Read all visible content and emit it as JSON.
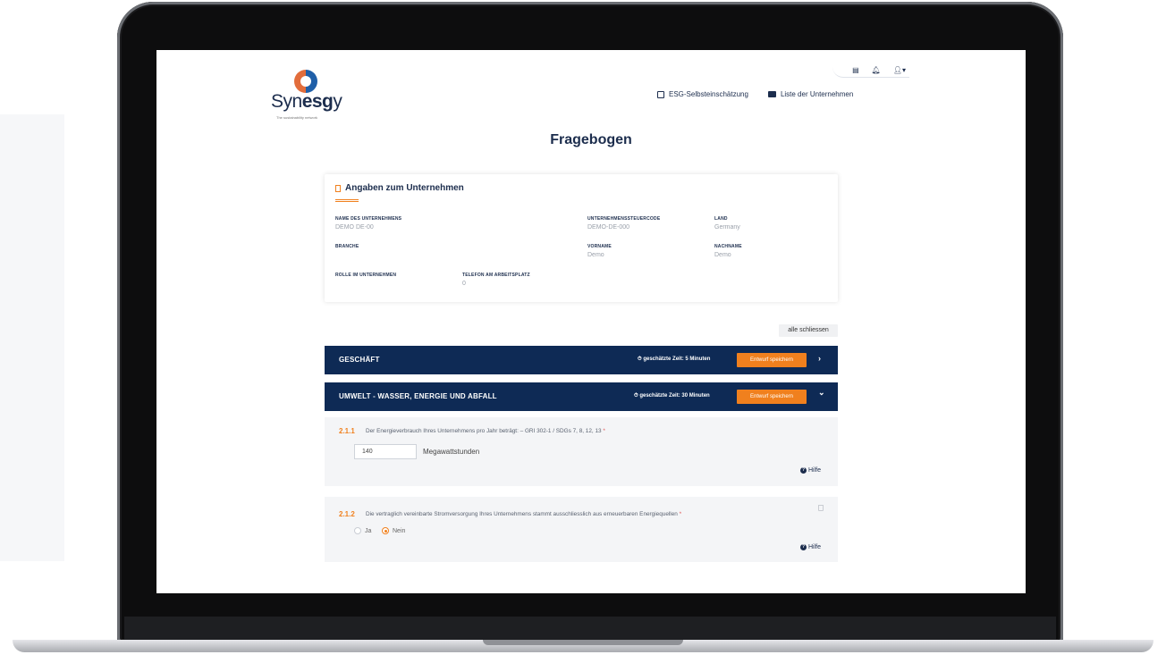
{
  "brand": {
    "name_prefix": "Syn",
    "name_bold": "esg",
    "name_suffix": "y",
    "tagline": "The sustainability network"
  },
  "topicons": [
    "flag-icon",
    "bell-icon",
    "user-icon"
  ],
  "nav": {
    "self_assessment": "ESG-Selbsteinschätzung",
    "companies": "Liste der Unternehmen"
  },
  "page": {
    "title": "Fragebogen"
  },
  "company_card": {
    "title": "Angaben zum Unternehmen",
    "fields": {
      "company_name": {
        "label": "NAME DES UNTERNEHMENS",
        "value": "DEMO DE-00"
      },
      "tax_code": {
        "label": "UNTERNEHMENSSTEUERCODE",
        "value": "DEMO-DE-000"
      },
      "country": {
        "label": "LAND",
        "value": "Germany"
      },
      "industry": {
        "label": "BRANCHE",
        "value": ""
      },
      "first_name": {
        "label": "VORNAME",
        "value": "Demo"
      },
      "last_name": {
        "label": "NACHNAME",
        "value": "Demo"
      },
      "role": {
        "label": "ROLLE IM UNTERNEHMEN",
        "value": ""
      },
      "phone": {
        "label": "TELEFON AM ARBEITSPLATZ",
        "value": "0"
      }
    }
  },
  "close_all": "alle schliessen",
  "sections": [
    {
      "title": "GESCHÄFT",
      "time": "⏱ geschätzte Zeit: 5 Minuten",
      "button": "Entwurf speichern",
      "chevron": "›"
    },
    {
      "title": "UMWELT - WASSER, ENERGIE UND ABFALL",
      "time": "⏱ geschätzte Zeit: 30 Minuten",
      "button": "Entwurf speichern",
      "chevron": "⌄"
    }
  ],
  "questions": [
    {
      "number": "2.1.1",
      "text": "Der Energieverbrauch Ihres Unternehmens pro Jahr beträgt: – GRI 302-1 / SDGs 7, 8, 12, 13",
      "required_mark": "*",
      "input_value": "140",
      "unit": "Megawattstunden",
      "help": "Hilfe"
    },
    {
      "number": "2.1.2",
      "text": "Die vertraglich vereinbarte Stromversorgung Ihres Unternehmens stammt ausschliesslich aus erneuerbaren Energiequellen",
      "required_mark": "*",
      "options": [
        "Ja",
        "Nein"
      ],
      "selected": "Nein",
      "help": "Hilfe"
    }
  ],
  "colors": {
    "navy": "#0e2a55",
    "orange": "#f0801e",
    "text_dark": "#1c2d4d"
  }
}
